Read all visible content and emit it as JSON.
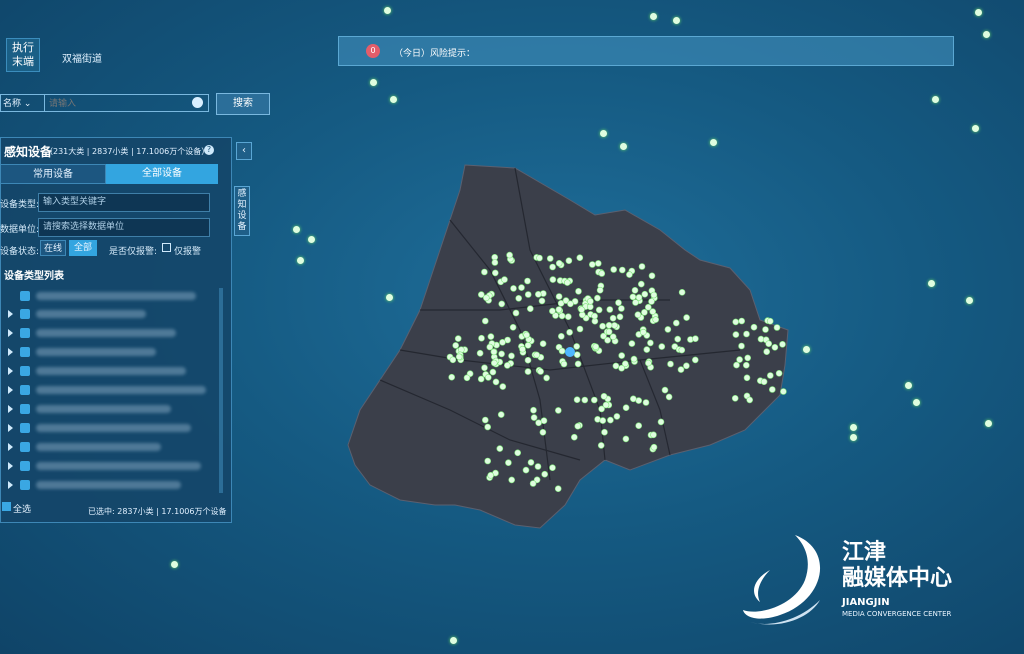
{
  "header": {
    "mode_button": "执行末端",
    "district": "双福街道"
  },
  "search": {
    "field": "名称",
    "placeholder": "请输入",
    "button": "搜索"
  },
  "alert": {
    "count": "0",
    "text": "（今日）风险提示："
  },
  "panel": {
    "title": "感知设备",
    "stats": "（231大类 | 2837小类 | 17.1006万个设备）",
    "side_tab": "感知设备",
    "tabs": [
      "常用设备",
      "全部设备"
    ],
    "device_type_label": "设备类型:",
    "device_type_placeholder": "输入类型关键字",
    "source_unit_label": "数据单位:",
    "source_unit_placeholder": "请搜索选择数据单位",
    "status_label": "设备状态:",
    "status_online": "在线",
    "status_all": "全部",
    "alarm_label": "是否仅报警:",
    "alarm_option": "仅报警",
    "list_title": "设备类型列表",
    "select_all": "全选",
    "selected": "已选中: 2837小类 | 17.1006万个设备"
  },
  "colors": {
    "background": "#155a82",
    "map_fill": "#3b3f4a",
    "device_dot": "#dffde0",
    "accent": "#33a5e0"
  },
  "logo": {
    "name_cn": "江津\n融媒体中心",
    "name_en": "JIANGJIN",
    "subtitle_en": "MEDIA CONVERGENCE CENTER"
  }
}
